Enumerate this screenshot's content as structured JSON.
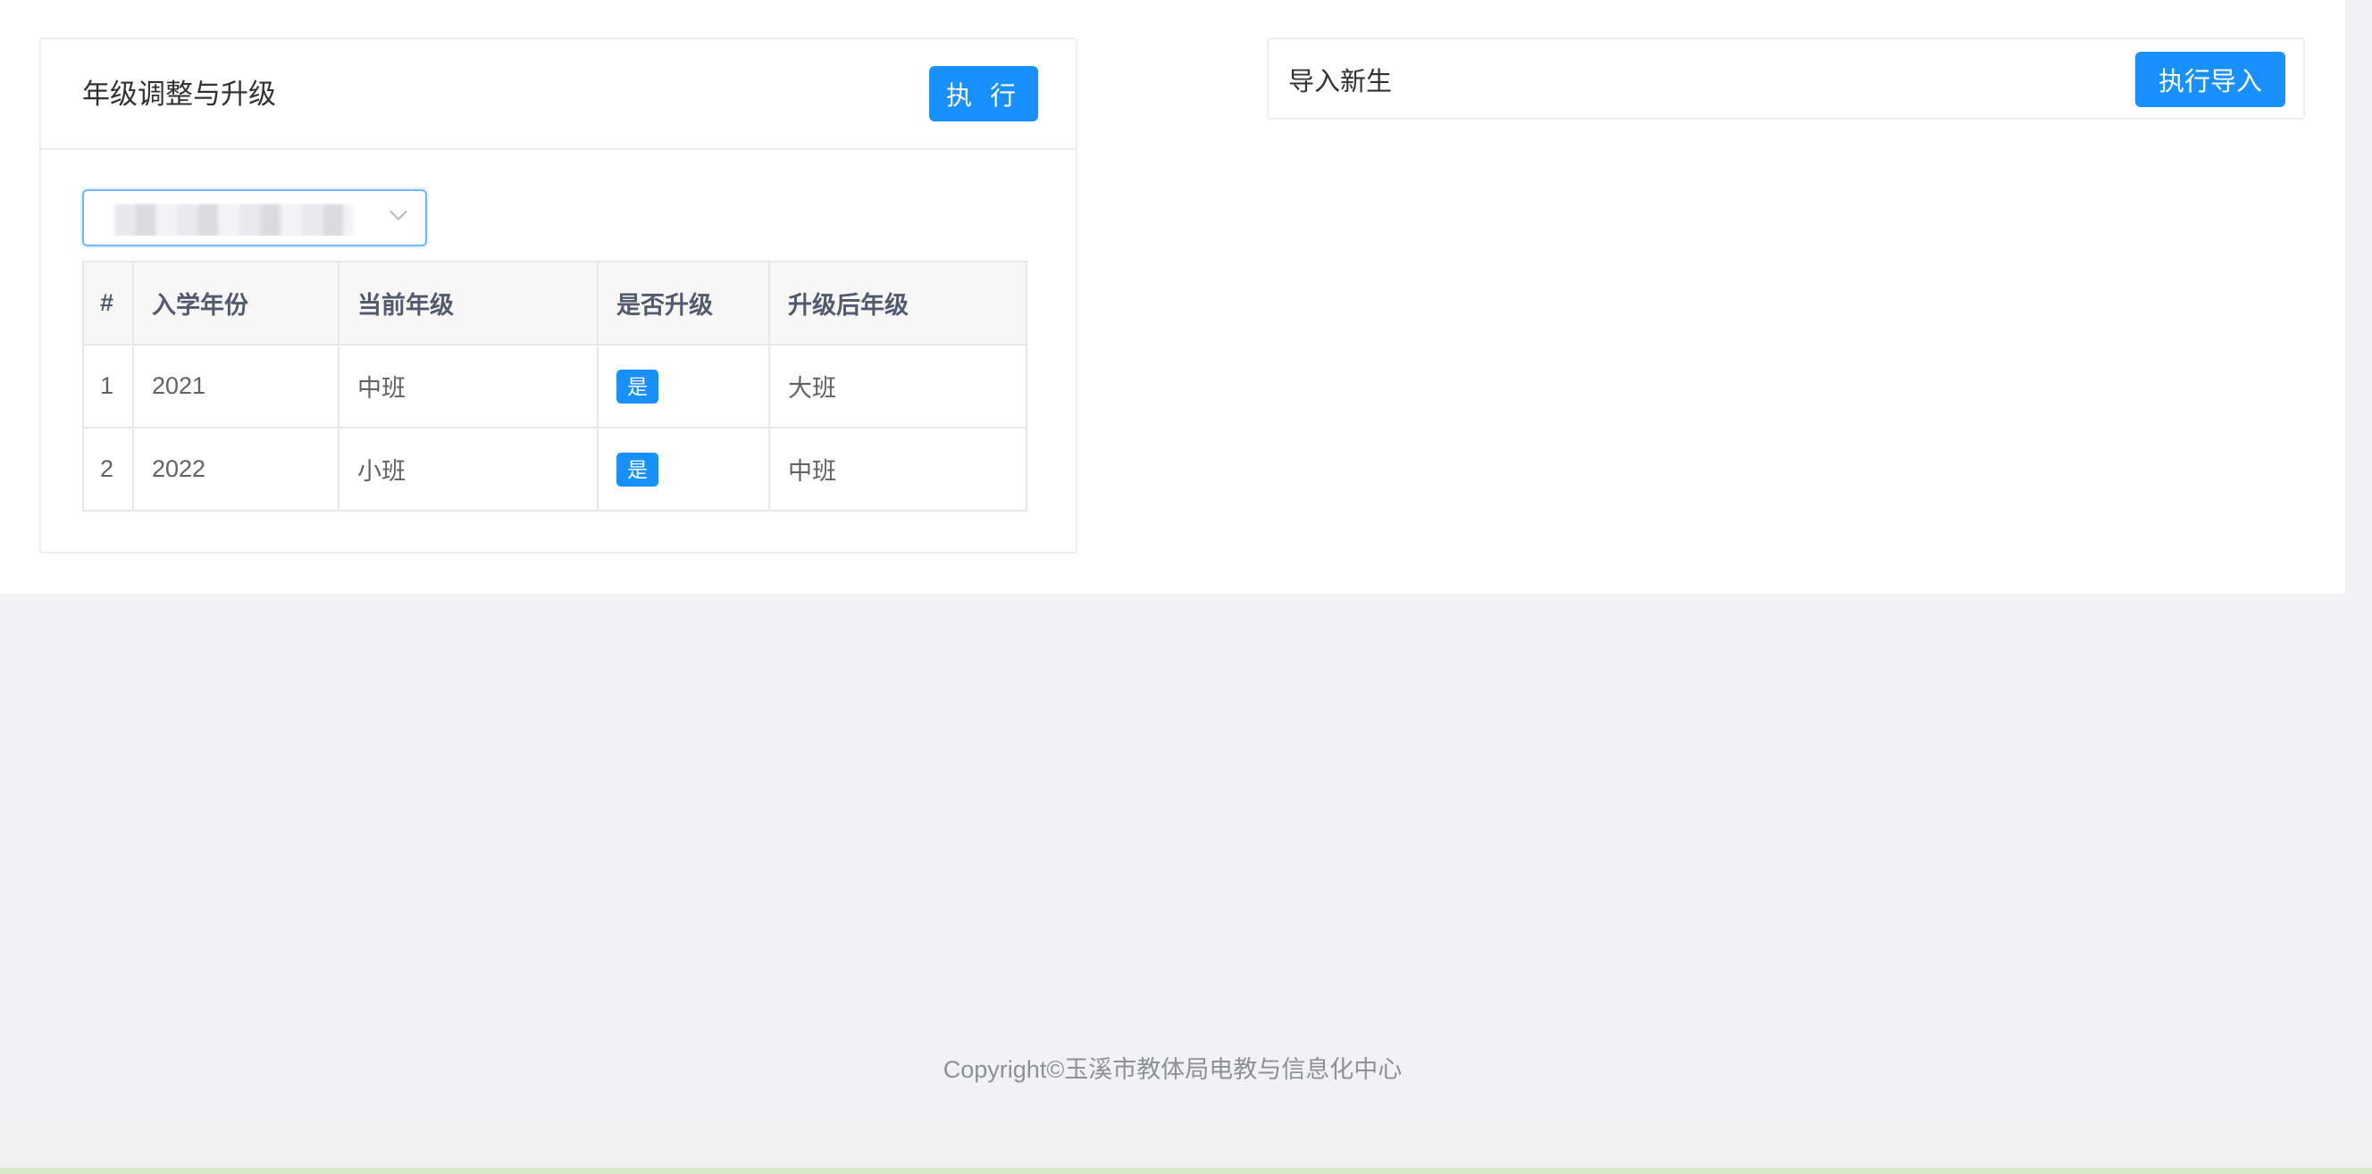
{
  "grade_card": {
    "title": "年级调整与升级",
    "execute_label": "执 行",
    "select": {
      "value": ""
    },
    "table": {
      "headers": [
        "#",
        "入学年份",
        "当前年级",
        "是否升级",
        "升级后年级"
      ],
      "rows": [
        {
          "index": "1",
          "year": "2021",
          "current": "中班",
          "upgrade": "是",
          "after": "大班"
        },
        {
          "index": "2",
          "year": "2022",
          "current": "小班",
          "upgrade": "是",
          "after": "中班"
        }
      ]
    }
  },
  "import_card": {
    "title": "导入新生",
    "import_label": "执行导入"
  },
  "footer": {
    "copyright": "Copyright©玉溪市教体局电教与信息化中心"
  },
  "colors": {
    "primary": "#1890ff",
    "border": "#eceef2",
    "bg": "#f0f2f5"
  }
}
